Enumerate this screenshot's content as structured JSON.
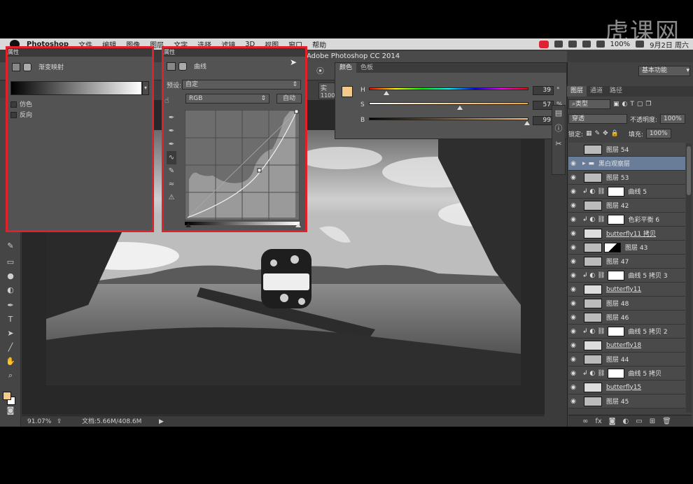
{
  "watermark": {
    "logo": "虎课网"
  },
  "menubar": {
    "items": [
      "Photoshop",
      "文件",
      "编辑",
      "图像",
      "图层",
      "文字",
      "选择",
      "滤镜",
      "3D",
      "视图",
      "窗口",
      "帮助"
    ],
    "battery": "100%",
    "datetime": "9月2日 周六"
  },
  "document": {
    "title": "Adobe Photoshop CC 2014",
    "tab_fragment": "1100",
    "tab_label": "实"
  },
  "status": {
    "zoom": "91.07%",
    "doc_size": "文档:5.66M/408.6M"
  },
  "gradient_map_panel": {
    "header": "属性",
    "title": "渐变映射",
    "dither_label": "仿色",
    "reverse_label": "反向"
  },
  "curves_panel": {
    "header": "属性",
    "title": "曲线",
    "preset_label": "预设:",
    "preset_value": "自定",
    "channel_value": "RGB",
    "auto_button": "自动"
  },
  "color_panel": {
    "tabs": [
      "颜色",
      "色板"
    ],
    "foreground_color": "#f3c98a",
    "h_label": "H",
    "h_value": "39",
    "h_unit": "°",
    "h_level": 39,
    "s_label": "S",
    "s_value": "57",
    "s_unit": "%",
    "s_level": 57,
    "b_label": "B",
    "b_value": "99",
    "b_unit": "%",
    "b_level": 99
  },
  "layers_panel": {
    "workspace": "基本功能",
    "tabs": [
      "图层",
      "通道",
      "路径"
    ],
    "filter_type": "类型",
    "blend_mode": "穿透",
    "opacity_label": "不透明度:",
    "opacity_value": "100%",
    "lock_label": "锁定:",
    "fill_label": "填充:",
    "fill_value": "100%",
    "layers": [
      {
        "name": "图层 54",
        "kind": "pixel",
        "visible": false,
        "selected": false
      },
      {
        "name": "黑白观察层",
        "kind": "group",
        "visible": true,
        "selected": true
      },
      {
        "name": "图层 53",
        "kind": "pixel",
        "visible": true,
        "selected": false
      },
      {
        "name": "曲线 5",
        "kind": "adjustment",
        "visible": true,
        "selected": false
      },
      {
        "name": "图层 42",
        "kind": "pixel",
        "visible": true,
        "selected": false
      },
      {
        "name": "色彩平衡 6",
        "kind": "adjustment",
        "visible": true,
        "selected": false
      },
      {
        "name": "butterfly11 拷贝",
        "kind": "smart",
        "visible": true,
        "selected": false
      },
      {
        "name": "图层 43",
        "kind": "masked",
        "visible": true,
        "selected": false
      },
      {
        "name": "图层 47",
        "kind": "pixel",
        "visible": true,
        "selected": false
      },
      {
        "name": "曲线 5 拷贝 3",
        "kind": "adjustment",
        "visible": true,
        "selected": false
      },
      {
        "name": "butterfly11",
        "kind": "smart",
        "visible": true,
        "selected": false
      },
      {
        "name": "图层 48",
        "kind": "pixel",
        "visible": true,
        "selected": false
      },
      {
        "name": "图层 46",
        "kind": "pixel",
        "visible": true,
        "selected": false
      },
      {
        "name": "曲线 5 拷贝 2",
        "kind": "adjustment",
        "visible": true,
        "selected": false
      },
      {
        "name": "butterfly18",
        "kind": "smart",
        "visible": true,
        "selected": false
      },
      {
        "name": "图层 44",
        "kind": "pixel",
        "visible": true,
        "selected": false
      },
      {
        "name": "曲线 5 拷贝",
        "kind": "adjustment",
        "visible": true,
        "selected": false
      },
      {
        "name": "butterfly15",
        "kind": "smart",
        "visible": true,
        "selected": false
      },
      {
        "name": "图层 45",
        "kind": "pixel",
        "visible": true,
        "selected": false
      }
    ]
  }
}
